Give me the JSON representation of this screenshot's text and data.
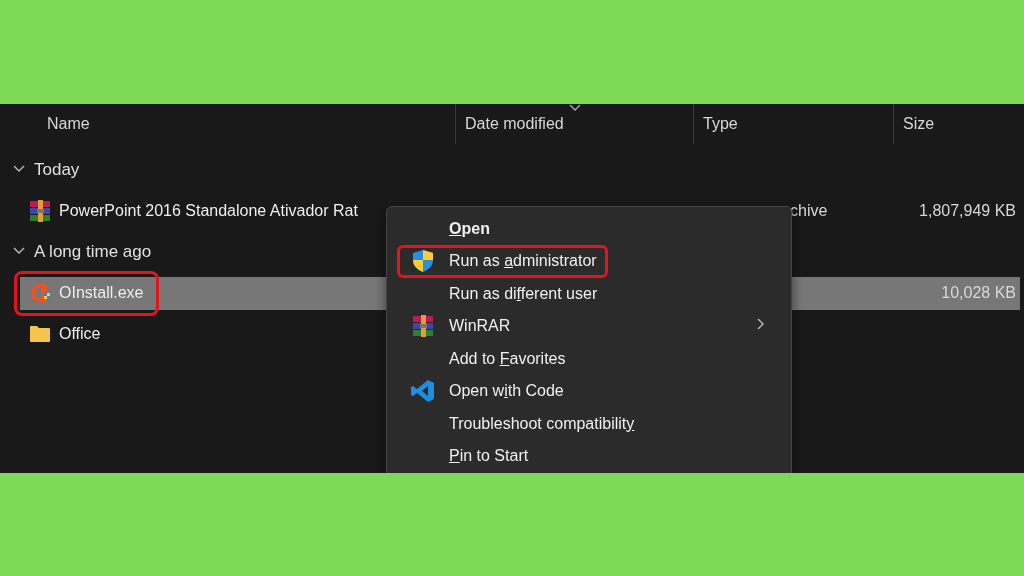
{
  "columns": [
    {
      "label": "Name",
      "sorted": false
    },
    {
      "label": "Date modified",
      "sorted": true
    },
    {
      "label": "Type",
      "sorted": false
    },
    {
      "label": "Size",
      "sorted": false
    }
  ],
  "groups": [
    {
      "label": "Today",
      "expanded": true,
      "files": [
        {
          "kind": "archive",
          "name": "PowerPoint 2016 Standalone Ativador Rat",
          "type": "chive",
          "size": "1,807,949 KB",
          "selected": false,
          "highlighted": false
        }
      ]
    },
    {
      "label": "A long time ago",
      "expanded": true,
      "files": [
        {
          "kind": "installer",
          "name": "OInstall.exe",
          "size": "10,028 KB",
          "selected": true,
          "highlighted": true
        },
        {
          "kind": "folder",
          "name": "Office",
          "selected": false,
          "highlighted": false
        }
      ]
    }
  ],
  "context_menu": {
    "items": [
      {
        "kind": "plain",
        "key": "O",
        "post": "pen",
        "bold": true,
        "highlighted": false,
        "submenu": false
      },
      {
        "kind": "shield",
        "pre": "Run as ",
        "key": "a",
        "post": "dministrator",
        "bold": false,
        "highlighted": true,
        "submenu": false
      },
      {
        "kind": "plain",
        "pre": "Run as di",
        "key": "f",
        "post": "ferent user",
        "bold": false,
        "highlighted": false,
        "submenu": false
      },
      {
        "kind": "archive",
        "pre": "WinRAR",
        "bold": false,
        "highlighted": false,
        "submenu": true
      },
      {
        "kind": "plain",
        "pre": "Add to ",
        "key": "F",
        "post": "avorites",
        "bold": false,
        "highlighted": false,
        "submenu": false
      },
      {
        "kind": "code",
        "pre": "Open w",
        "key": "i",
        "post": "th Code",
        "bold": false,
        "highlighted": false,
        "submenu": false
      },
      {
        "kind": "plain",
        "pre": "Troubleshoot compatibilit",
        "key": "y",
        "bold": false,
        "highlighted": false,
        "submenu": false
      },
      {
        "kind": "plain",
        "key": "P",
        "post": "in to Start",
        "bold": false,
        "highlighted": false,
        "submenu": false
      }
    ]
  }
}
